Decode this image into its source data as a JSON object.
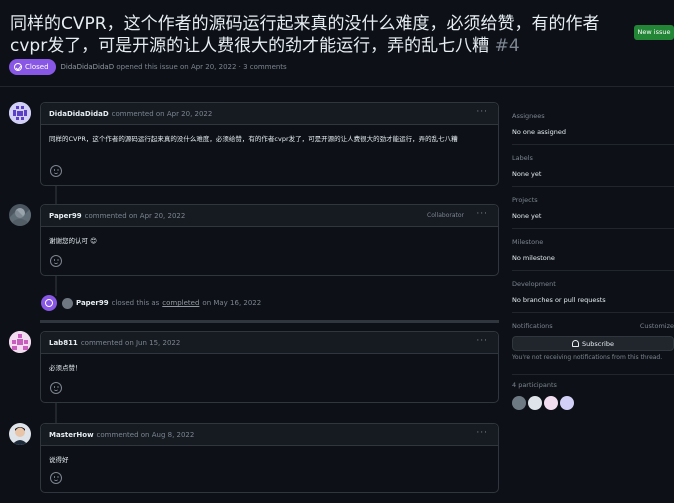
{
  "issue": {
    "title": "同样的CVPR，这个作者的源码运行起来真的没什么难度，必须给赞，有的作者cvpr发了，可是开源的让人费很大的劲才能运行，弄的乱七八糟",
    "number": "#4",
    "state": "Closed",
    "author": "DidaDidaDidaD",
    "opened_text": "opened this issue on Apr 20, 2022 · 3 comments"
  },
  "header": {
    "new_issue_label": "New issue"
  },
  "comments": [
    {
      "author": "DidaDidaDidaD",
      "when": "commented on Apr 20, 2022",
      "role": "",
      "body": "同样的CVPR，这个作者的源码运行起来真的没什么难度，必须给赞，有的作者cvpr发了，可是开源的让人费很大的劲才能运行，弄的乱七八糟"
    },
    {
      "author": "Paper99",
      "when": "commented on Apr 20, 2022",
      "role": "Collaborator",
      "body": "谢谢您的认可 😊"
    },
    {
      "author": "Lab811",
      "when": "commented on Jun 15, 2022",
      "role": "",
      "body": "必须点赞！"
    },
    {
      "author": "MasterHow",
      "when": "commented on Aug 8, 2022",
      "role": "",
      "body": "说得好"
    }
  ],
  "closed_event": {
    "actor": "Paper99",
    "text": "closed this as",
    "link": "completed",
    "date": "on May 16, 2022"
  },
  "sidebar": {
    "assignees": {
      "label": "Assignees",
      "value": "No one assigned"
    },
    "labels": {
      "label": "Labels",
      "value": "None yet"
    },
    "projects": {
      "label": "Projects",
      "value": "None yet"
    },
    "milestone": {
      "label": "Milestone",
      "value": "No milestone"
    },
    "development": {
      "label": "Development",
      "value": "No branches or pull requests"
    },
    "notifications": {
      "label": "Notifications",
      "customize": "Customize",
      "subscribe_label": "Subscribe",
      "note": "You're not receiving notifications from this thread."
    },
    "participants": {
      "label": "4 participants"
    }
  },
  "colors": {
    "background": "#0d1117",
    "closed_purple": "#8957e5",
    "new_issue_green": "#238636"
  }
}
